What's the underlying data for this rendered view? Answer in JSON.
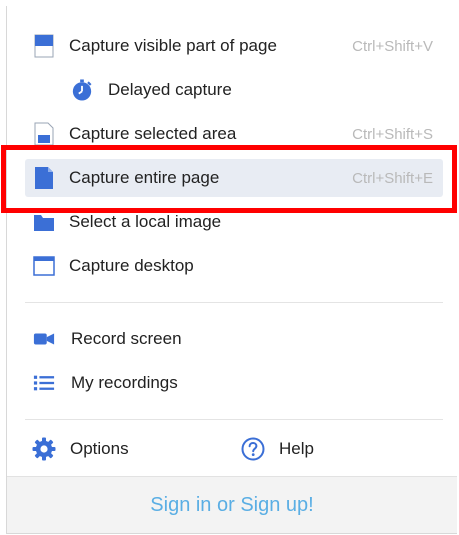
{
  "menu": {
    "items": [
      {
        "label": "Capture visible part of page",
        "shortcut": "Ctrl+Shift+V",
        "icon": "page-icon"
      },
      {
        "label": "Delayed capture",
        "shortcut": "",
        "icon": "timer-icon"
      },
      {
        "label": "Capture selected area",
        "shortcut": "Ctrl+Shift+S",
        "icon": "selected-area-icon"
      },
      {
        "label": "Capture entire page",
        "shortcut": "Ctrl+Shift+E",
        "icon": "entire-page-icon"
      },
      {
        "label": "Select a local image",
        "shortcut": "",
        "icon": "folder-icon"
      },
      {
        "label": "Capture desktop",
        "shortcut": "",
        "icon": "desktop-window-icon"
      },
      {
        "label": "Record screen",
        "shortcut": "",
        "icon": "video-camera-icon"
      },
      {
        "label": "My recordings",
        "shortcut": "",
        "icon": "list-icon"
      }
    ],
    "options_label": "Options",
    "help_label": "Help",
    "signin_label": "Sign in or Sign up!"
  },
  "colors": {
    "accent_blue": "#3b6fd6",
    "highlight": "#e8ecf3",
    "signin": "#5aaee4",
    "annotation_red": "#ff0000"
  }
}
